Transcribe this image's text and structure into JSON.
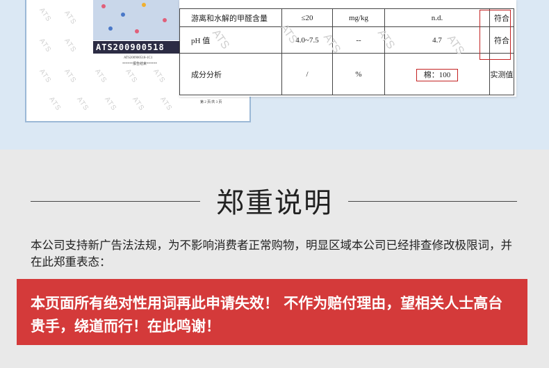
{
  "report": {
    "sample_code": "ATS200900518",
    "small_id": "ATS200900518-1C1",
    "small_end": "******报告结束******",
    "page_no": "第 2 页/共 3 页",
    "watermark": "ATS",
    "rows": [
      {
        "item": "游离和水解的甲醛含量",
        "limit": "≤20",
        "unit": "mg/kg",
        "result": "n.d.",
        "verdict": "符合"
      },
      {
        "item": "pH 值",
        "limit": "4.0~7.5",
        "unit": "--",
        "result": "4.7",
        "verdict": "符合"
      },
      {
        "item": "成分分析",
        "limit": "/",
        "unit": "%",
        "result": "棉：100",
        "verdict": "实测值"
      }
    ]
  },
  "statement": {
    "title": "郑重说明",
    "paragraph": "本公司支持新广告法法规，为不影响消费者正常购物，明显区域本公司已经排查修改极限词，并在此郑重表态：",
    "alert": "本页面所有绝对性用词再此申请失效！ 不作为赔付理由，望相关人士高台贵手，绕道而行！在此鸣谢！"
  },
  "colors": {
    "band": "#dbe8f4",
    "background": "#e9e9e9",
    "alert": "#d43a3a",
    "highlight": "#c32121"
  }
}
